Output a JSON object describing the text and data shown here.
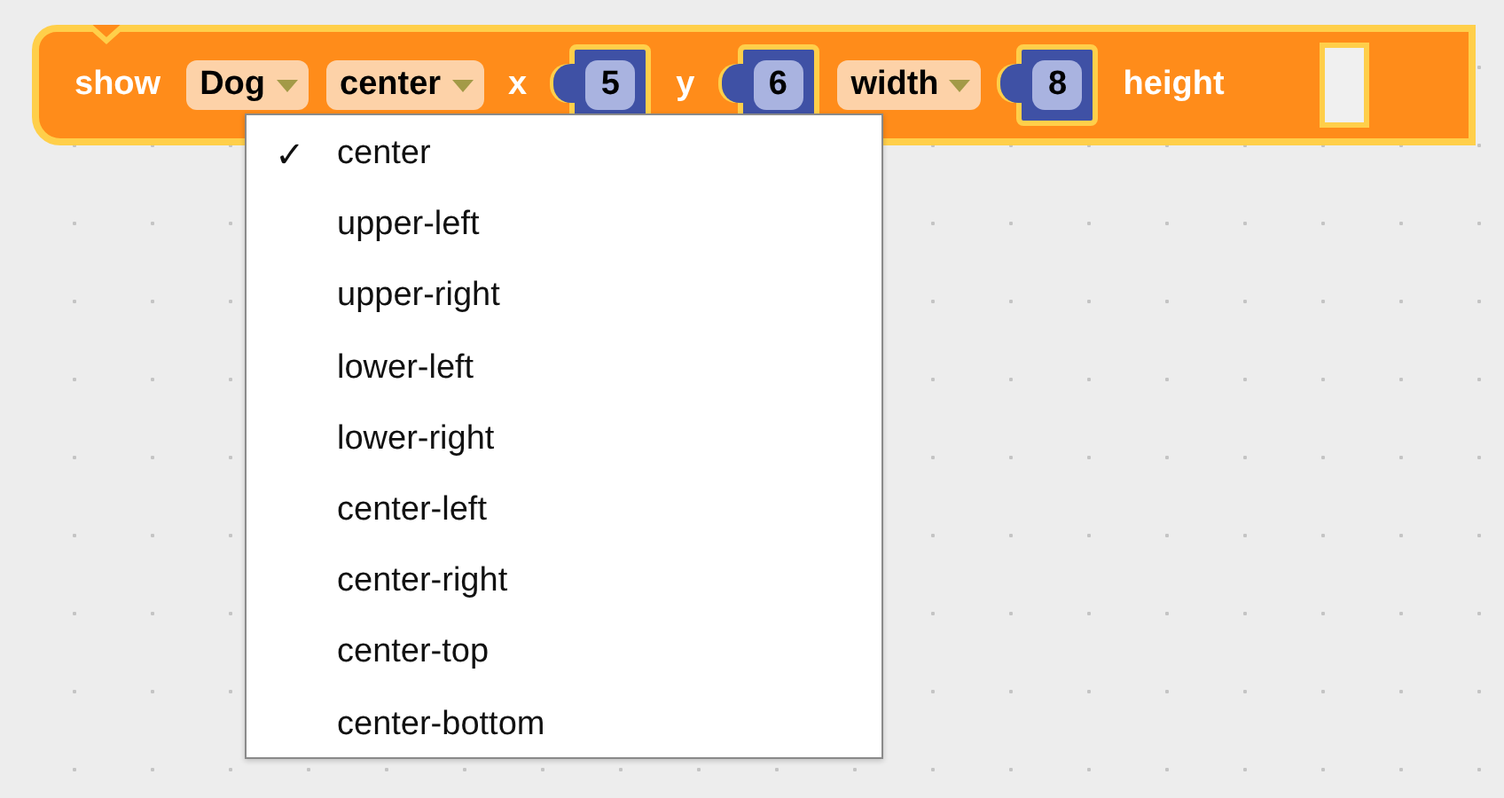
{
  "block": {
    "items": [
      {
        "kind": "label",
        "text": "show"
      },
      {
        "kind": "dropdown",
        "text": "Dog"
      },
      {
        "kind": "dropdown",
        "text": "center"
      },
      {
        "kind": "label",
        "text": "x"
      },
      {
        "kind": "number",
        "text": "5"
      },
      {
        "kind": "label",
        "text": "y"
      },
      {
        "kind": "number",
        "text": "6"
      },
      {
        "kind": "dropdown",
        "text": "width"
      },
      {
        "kind": "number",
        "text": "8"
      },
      {
        "kind": "label",
        "text": "height"
      },
      {
        "kind": "slot"
      }
    ]
  },
  "menu": {
    "check": "✓",
    "items": [
      {
        "label": "center",
        "selected": true
      },
      {
        "label": "upper-left",
        "selected": false
      },
      {
        "label": "upper-right",
        "selected": false
      },
      {
        "label": "lower-left",
        "selected": false
      },
      {
        "label": "lower-right",
        "selected": false
      },
      {
        "label": "center-left",
        "selected": false
      },
      {
        "label": "center-right",
        "selected": false
      },
      {
        "label": "center-top",
        "selected": false
      },
      {
        "label": "center-bottom",
        "selected": false
      }
    ]
  }
}
